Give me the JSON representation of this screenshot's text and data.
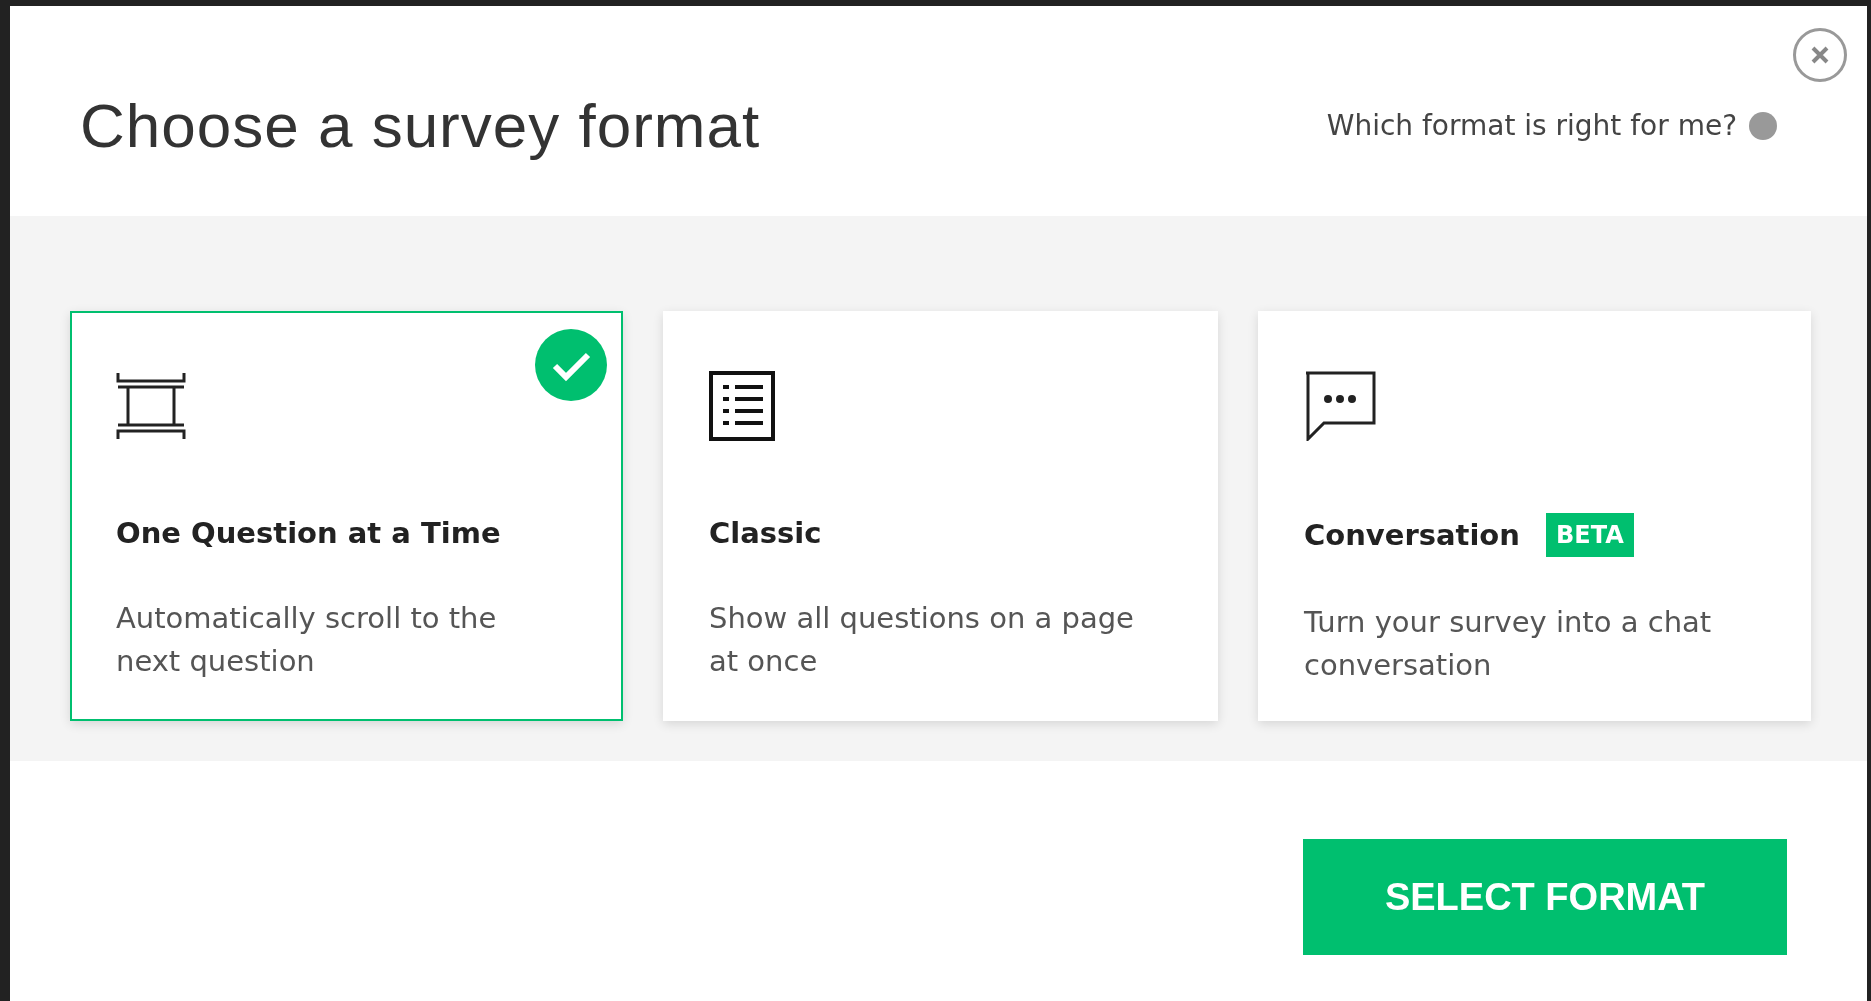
{
  "dialog": {
    "title": "Choose a survey format",
    "help_link": "Which format is right for me?"
  },
  "formats": [
    {
      "kind": "stack",
      "title": "One Question at a Time",
      "description": "Automatically scroll to the next question",
      "selected": true
    },
    {
      "kind": "list",
      "title": "Classic",
      "description": "Show all questions on a page at once",
      "selected": false
    },
    {
      "kind": "chat",
      "title": "Conversation",
      "badge": "BETA",
      "description": "Turn your survey into a chat conversation",
      "selected": false
    }
  ],
  "primary_button": "SELECT FORMAT"
}
